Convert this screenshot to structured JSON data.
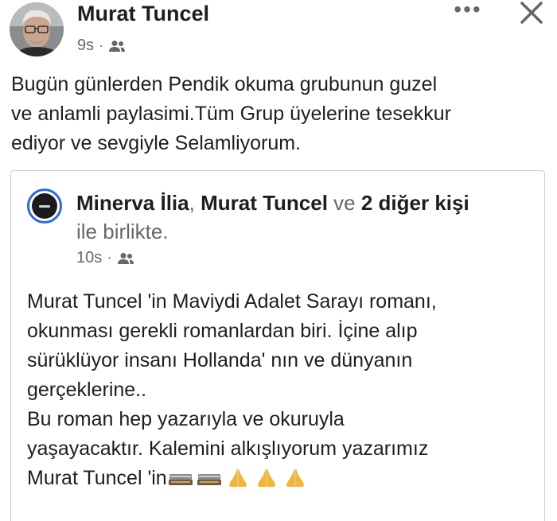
{
  "post": {
    "author": "Murat Tuncel",
    "time": "9s",
    "meta_separator": "·",
    "audience_icon": "group-icon",
    "more_label": "•••",
    "text_lines": [
      "Bugün günlerden Pendik okuma grubunun guzel",
      "ve anlamli paylasimi.Tüm  Grup üyelerine tesekkur",
      "ediyor ve sevgiyle Selamliyorum."
    ]
  },
  "shared_post": {
    "names_prefix_bold_1": "Minerva İlia",
    "comma": ", ",
    "names_bold_2": "Murat Tuncel",
    "connector": " ve ",
    "names_bold_3": "2 diğer kişi",
    "names_line2": "ile birlikte.",
    "time": "10s",
    "meta_separator": "·",
    "audience_icon": "group-icon",
    "text_lines": [
      "Murat Tuncel 'in Maviydi Adalet Sarayı romanı,",
      "okunması gerekli romanlardan biri. İçine alıp",
      "sürüklüyor insanı Hollanda' nın ve dünyanın",
      "gerçeklerine..",
      "Bu roman hep yazarıyla ve okuruyla",
      "yaşayacaktır. Kalemini alkışlıyorum yazarımız"
    ],
    "last_line_text": "Murat Tuncel 'in",
    "emojis": [
      "books-emoji",
      "books-emoji",
      "folded-hands-emoji",
      "folded-hands-emoji",
      "folded-hands-emoji"
    ]
  },
  "colors": {
    "text": "#1c1e21",
    "secondary_text": "#65676b",
    "card_border": "#c9ccd1",
    "accent_ring": "#2d6ad6"
  }
}
